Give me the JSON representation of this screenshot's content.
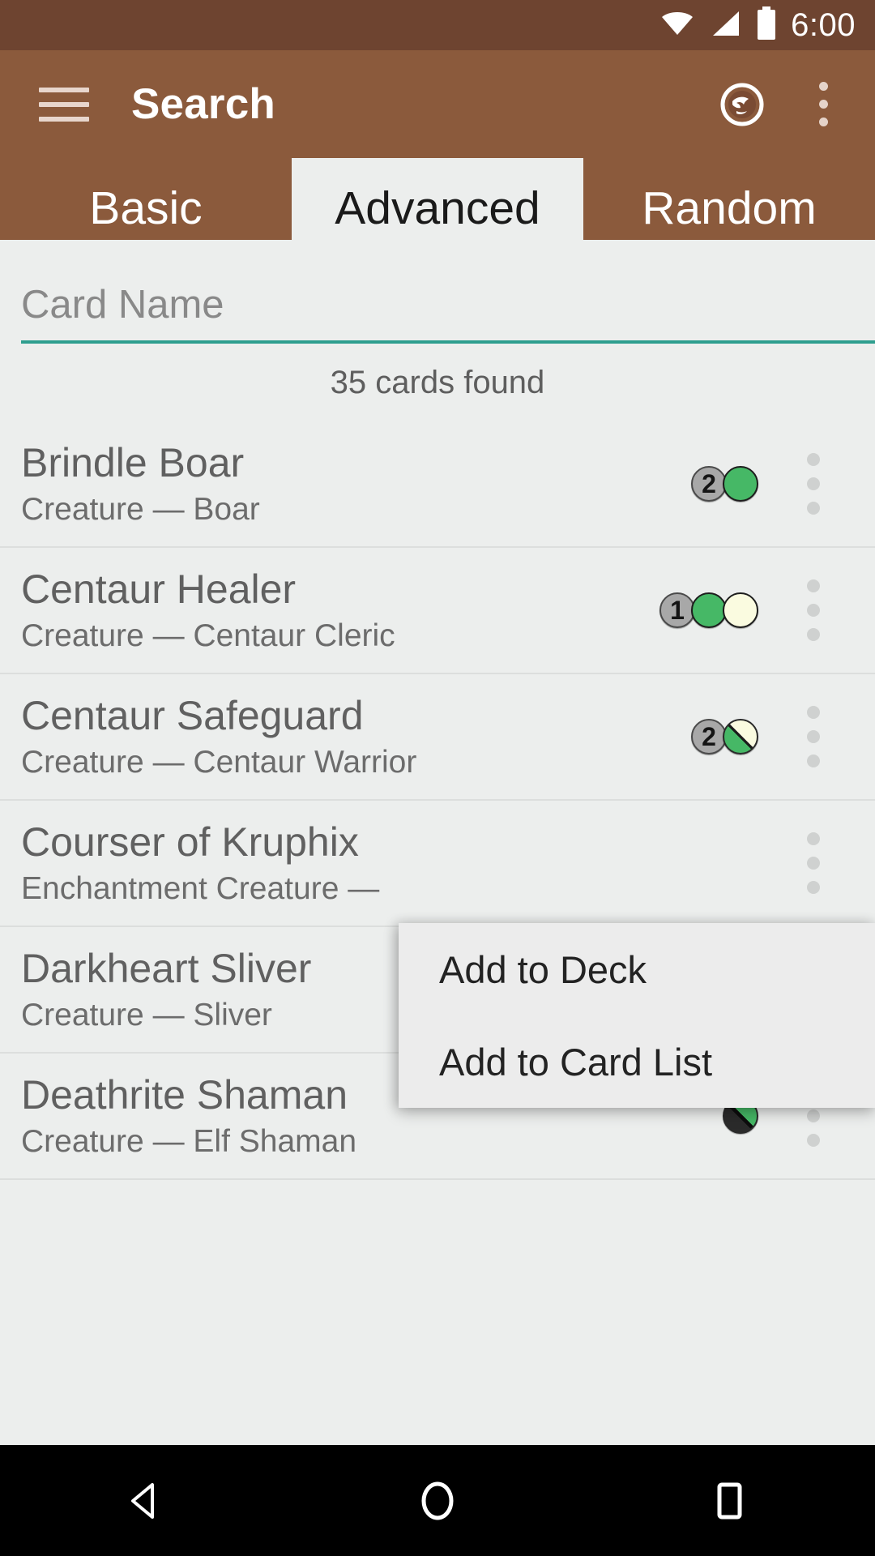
{
  "statusbar": {
    "clock": "6:00",
    "icons": [
      "wifi-icon",
      "cellular-signal-icon",
      "battery-icon"
    ]
  },
  "toolbar": {
    "menu_icon": "hamburger-menu-icon",
    "title": "Search",
    "action_icon": "mana-symbol-icon",
    "overflow_icon": "overflow-menu-icon"
  },
  "tabs": [
    {
      "label": "Basic",
      "active": false
    },
    {
      "label": "Advanced",
      "active": true
    },
    {
      "label": "Random",
      "active": false
    }
  ],
  "search": {
    "placeholder": "Card Name",
    "value": "",
    "search_button_icon": "magnifier-icon",
    "expand_button_icon": "chevron-down-circle-icon",
    "accent_color": "#2e9e8f"
  },
  "results": {
    "count_text": "35 cards found",
    "cards": [
      {
        "name": "Brindle Boar",
        "type": "Creature  —  Boar",
        "mana": [
          {
            "kind": "generic",
            "label": "2"
          },
          {
            "kind": "green",
            "label": ""
          }
        ],
        "menu_highlighted": false
      },
      {
        "name": "Centaur Healer",
        "type": "Creature  —  Centaur Cleric",
        "mana": [
          {
            "kind": "generic",
            "label": "1"
          },
          {
            "kind": "green",
            "label": ""
          },
          {
            "kind": "white",
            "label": ""
          }
        ],
        "menu_highlighted": false
      },
      {
        "name": "Centaur Safeguard",
        "type": "Creature  —  Centaur Warrior",
        "mana": [
          {
            "kind": "generic",
            "label": "2"
          },
          {
            "kind": "split-gw",
            "label": ""
          }
        ],
        "menu_highlighted": false
      },
      {
        "name": "Courser of Kruphix",
        "type": "Enchantment Creature  —",
        "mana": [],
        "menu_highlighted": false
      },
      {
        "name": "Darkheart Sliver",
        "type": "Creature  —  Sliver",
        "mana": [
          {
            "kind": "black",
            "label": ""
          },
          {
            "kind": "green",
            "label": ""
          }
        ],
        "menu_highlighted": true
      },
      {
        "name": "Deathrite Shaman",
        "type": "Creature  —  Elf Shaman",
        "mana": [
          {
            "kind": "split-bg",
            "label": ""
          }
        ],
        "menu_highlighted": false
      }
    ]
  },
  "popup_menu": {
    "items": [
      {
        "label": "Add to Deck"
      },
      {
        "label": "Add to Card List"
      }
    ]
  },
  "navbar": {
    "back": "back-triangle-icon",
    "home": "home-circle-icon",
    "recents": "recents-square-icon"
  },
  "colors": {
    "status_bar": "#6e4430",
    "toolbar": "#8b5a3c",
    "surface": "#eceeed",
    "accent": "#2e9e8f",
    "highlight_dots": "#f5c400"
  }
}
